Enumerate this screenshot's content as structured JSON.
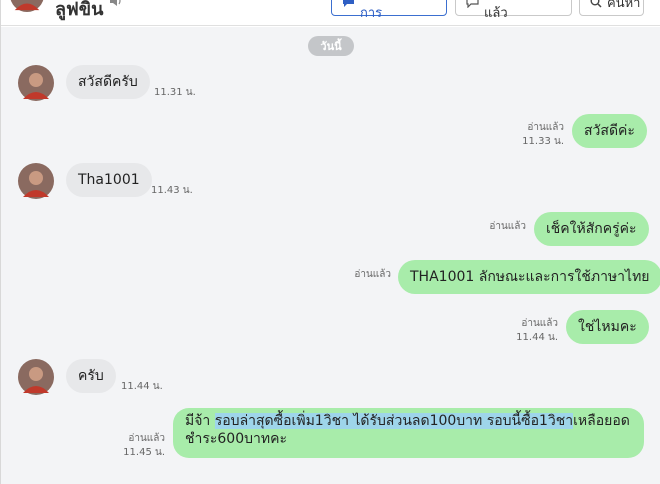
{
  "header": {
    "contact_name": "ลูฟขิน",
    "buttons": {
      "todo": "ต้องดำเนินการ",
      "done": "ดำเนินการแล้ว",
      "search": "ค้นหา"
    }
  },
  "chat": {
    "day_separator": "วันนี้",
    "messages": [
      {
        "direction": "in",
        "text": "สวัสดีครับ",
        "time": "11.31 น."
      },
      {
        "direction": "out",
        "text": "สวัสดีค่ะ",
        "read": "อ่านแล้ว",
        "time": "11.33 น."
      },
      {
        "direction": "in",
        "text": "Tha1001",
        "time": "11.43 น."
      },
      {
        "direction": "out",
        "text": "เช็คให้สักครู่ค่ะ",
        "read": "อ่านแล้ว",
        "time": ""
      },
      {
        "direction": "out",
        "text": "THA1001 ลักษณะและการใช้ภาษาไทย",
        "read": "อ่านแล้ว",
        "time": ""
      },
      {
        "direction": "out",
        "text": "ใช่ไหมคะ",
        "read": "อ่านแล้ว",
        "time": "11.44 น."
      },
      {
        "direction": "in",
        "text": "ครับ",
        "time": "11.44 น."
      },
      {
        "direction": "out",
        "text_prefix": "มีจ้า ",
        "text_highlight": "รอบล่าสุดซื้อเพิ่ม1วิชา ได้รับส่วนลด100บาท รอบนี้ซื้อ1วิชา",
        "text_suffix": "เหลือยอดชำระ600บาทคะ",
        "read": "อ่านแล้ว",
        "time": "11.45 น."
      }
    ]
  },
  "colors": {
    "incoming_bubble": "#e7e8ea",
    "outgoing_bubble": "#a8ecaa",
    "chat_background": "#f3f4f6",
    "primary_accent": "#2f5fc4",
    "selection_highlight": "#9ed5ea"
  },
  "icons": {
    "speaker": "speaker-icon",
    "todo": "chat-bubble-icon",
    "done": "chat-bubble-icon",
    "search": "search-icon"
  }
}
